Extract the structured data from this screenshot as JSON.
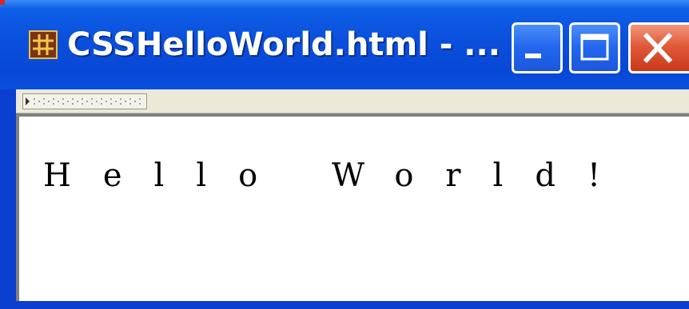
{
  "window": {
    "title": "CSSHelloWorld.html - ...",
    "controls": {
      "minimize": "minimize-icon",
      "maximize": "maximize-icon",
      "close": "close-icon"
    },
    "app_icon": "hash-grid-icon"
  },
  "toolbar": {
    "grip_icon": "toolbar-grip-icon"
  },
  "content": {
    "text": "Hello World!"
  },
  "colors": {
    "titlebar": "#0a4fdc",
    "close_button": "#e25a3a",
    "toolbar": "#ece9d8",
    "content_background": "#ffffff"
  }
}
